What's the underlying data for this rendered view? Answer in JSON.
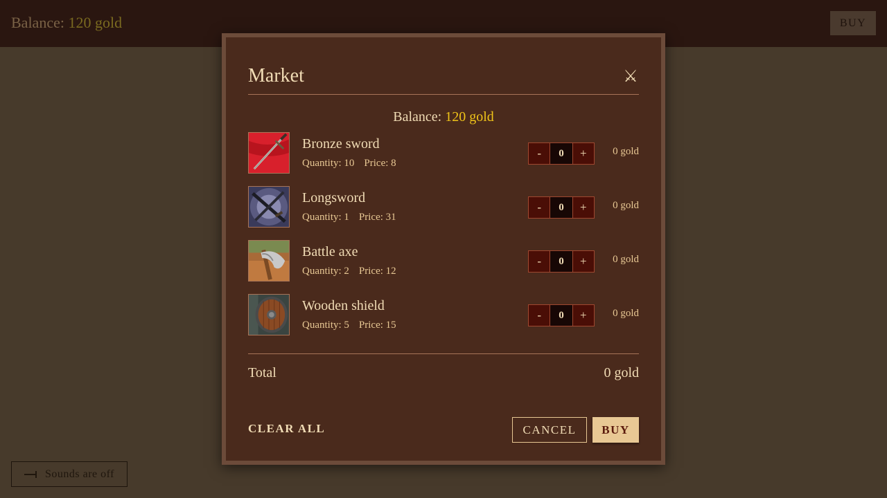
{
  "topbar": {
    "balance_label": "Balance:",
    "balance_value": "120 gold",
    "buy_label": "BUY"
  },
  "sounds": {
    "label": "Sounds are off",
    "icon": "speaker-off-icon"
  },
  "market": {
    "title": "Market",
    "close_icon": "crossed-swords-icon",
    "balance_label": "Balance:",
    "balance_value": "120 gold",
    "items": [
      {
        "name": "Bronze sword",
        "quantity_label": "Quantity: 10",
        "price_label": "Price: 8",
        "count": "0",
        "cost": "0 gold",
        "image": "bronze-sword"
      },
      {
        "name": "Longsword",
        "quantity_label": "Quantity: 1",
        "price_label": "Price: 31",
        "count": "0",
        "cost": "0 gold",
        "image": "longsword"
      },
      {
        "name": "Battle axe",
        "quantity_label": "Quantity: 2",
        "price_label": "Price: 12",
        "count": "0",
        "cost": "0 gold",
        "image": "battle-axe"
      },
      {
        "name": "Wooden shield",
        "quantity_label": "Quantity: 5",
        "price_label": "Price: 15",
        "count": "0",
        "cost": "0 gold",
        "image": "wooden-shield"
      }
    ],
    "minus": "-",
    "plus": "+",
    "total_label": "Total",
    "total_value": "0 gold",
    "clear_all_label": "CLEAR ALL",
    "cancel_label": "CANCEL",
    "buy_label": "BUY"
  },
  "colors": {
    "gold_text": "#f0c419",
    "accent_button": "#e8c894",
    "stepper_bg": "#4a0e06",
    "panel_bg": "#4a2a1c"
  }
}
